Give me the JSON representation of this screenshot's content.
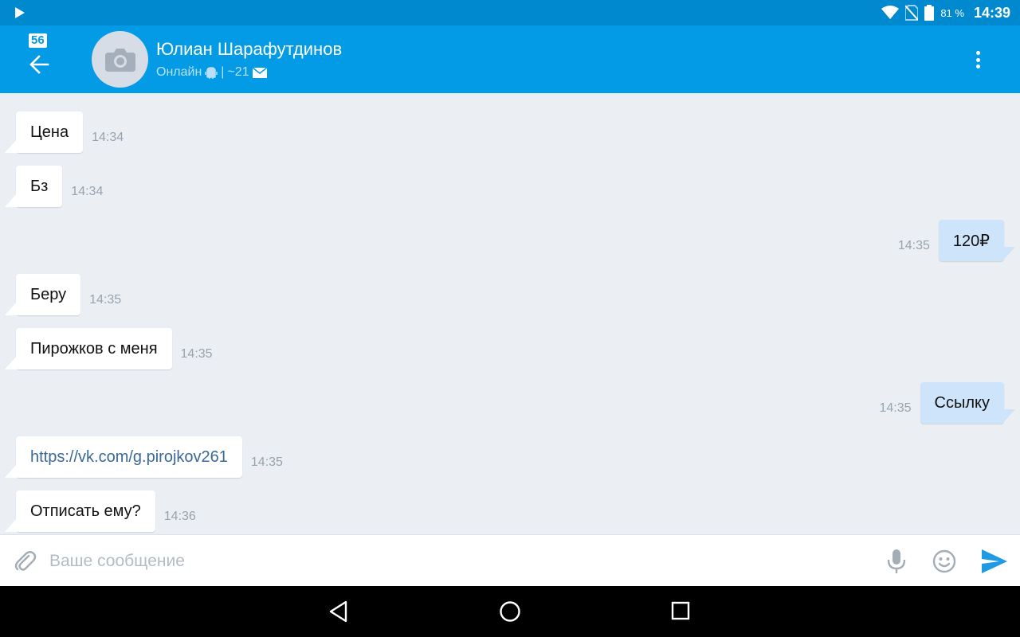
{
  "status_bar": {
    "battery_percent": "81 %",
    "time": "14:39"
  },
  "header": {
    "badge_count": "56",
    "contact_name": "Юлиан Шарафутдинов",
    "status_text": "Онлайн",
    "separator": "|",
    "message_count": "~21"
  },
  "messages": [
    {
      "direction": "in",
      "text": "Цена",
      "time": "14:34"
    },
    {
      "direction": "in",
      "text": "Бз",
      "time": "14:34"
    },
    {
      "direction": "out",
      "text": "120₽",
      "time": "14:35"
    },
    {
      "direction": "in",
      "text": "Беру",
      "time": "14:35"
    },
    {
      "direction": "in",
      "text": "Пирожков с меня",
      "time": "14:35"
    },
    {
      "direction": "out",
      "text": "Ссылку",
      "time": "14:35"
    },
    {
      "direction": "in",
      "text": "https://vk.com/g.pirojkov261",
      "time": "14:35",
      "is_link": true
    },
    {
      "direction": "in",
      "text": "Отписать ему?",
      "time": "14:36"
    }
  ],
  "composer": {
    "placeholder": "Ваше сообщение",
    "value": ""
  },
  "colors": {
    "status_bar": "#0189d0",
    "header": "#039be5",
    "chat_bg": "#ebeff4",
    "incoming_bubble": "#ffffff",
    "outgoing_bubble": "#cde4fa",
    "send_icon": "#1e9be3"
  },
  "icons": {
    "status": [
      "play-icon",
      "wifi-icon",
      "no-sim-icon",
      "battery-icon"
    ],
    "header": [
      "back-arrow-icon",
      "camera-icon",
      "android-icon",
      "envelope-icon",
      "more-vert-icon"
    ],
    "composer": [
      "paperclip-icon",
      "microphone-icon",
      "smiley-icon",
      "send-icon"
    ],
    "nav": [
      "nav-back-icon",
      "nav-home-icon",
      "nav-recent-icon"
    ]
  }
}
